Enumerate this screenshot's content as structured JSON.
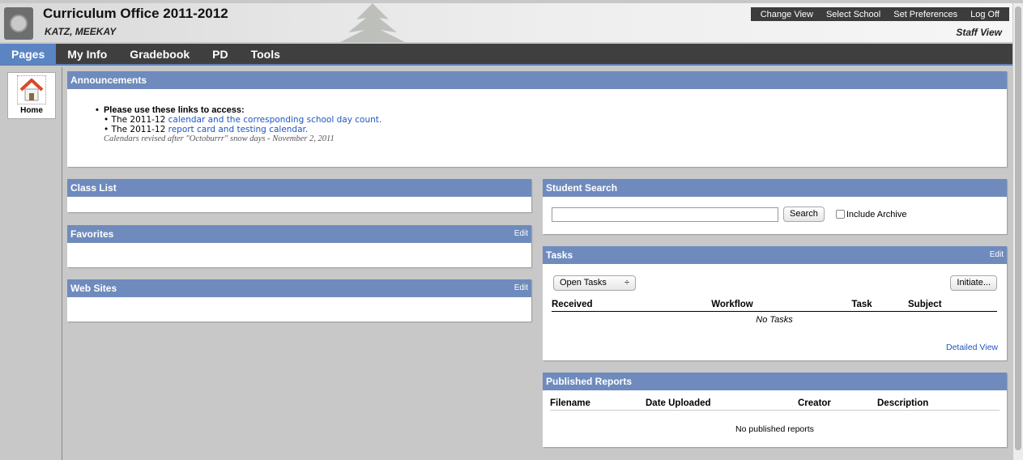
{
  "header": {
    "title": "Curriculum Office 2011-2012",
    "user": "KATZ, MEEKAY",
    "view_label": "Staff View",
    "top_links": [
      "Change View",
      "Select School",
      "Set Preferences",
      "Log Off"
    ]
  },
  "nav": {
    "tabs": [
      "Pages",
      "My Info",
      "Gradebook",
      "PD",
      "Tools"
    ]
  },
  "sidebar": {
    "home_label": "Home"
  },
  "announcements": {
    "title": "Announcements",
    "lead": "Please use these links to access:",
    "item1_prefix": "The 2011-12 ",
    "item1_link": "calendar and the corresponding school day count.",
    "item2_prefix": "The 2011-12 ",
    "item2_link": "report card and testing calendar.",
    "note": "Calendars revised after \"Octoburrr\" snow days - November 2, 2011"
  },
  "class_list": {
    "title": "Class List"
  },
  "favorites": {
    "title": "Favorites",
    "edit": "Edit"
  },
  "web_sites": {
    "title": "Web Sites",
    "edit": "Edit"
  },
  "student_search": {
    "title": "Student Search",
    "search_button": "Search",
    "include_archive": "Include Archive"
  },
  "tasks": {
    "title": "Tasks",
    "edit": "Edit",
    "filter": "Open Tasks",
    "initiate_button": "Initiate...",
    "columns": [
      "Received",
      "Workflow",
      "Task",
      "Subject"
    ],
    "empty": "No Tasks",
    "detailed_view": "Detailed View"
  },
  "published_reports": {
    "title": "Published Reports",
    "columns": [
      "Filename",
      "Date Uploaded",
      "Creator",
      "Description"
    ],
    "empty": "No published reports"
  }
}
